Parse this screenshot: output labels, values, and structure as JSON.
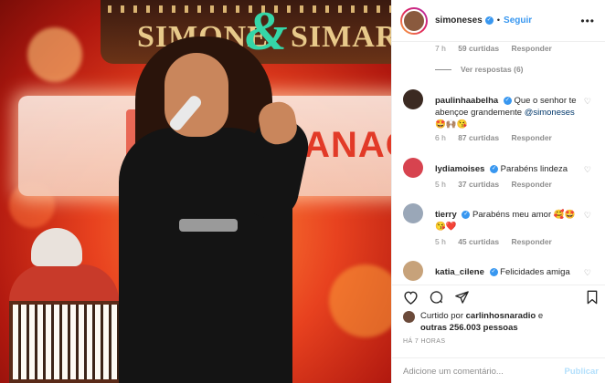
{
  "photo": {
    "banner_text": "GANAÇ",
    "logo_left": "SIMONE",
    "logo_amp": "&",
    "logo_right": "SIMARIA"
  },
  "header": {
    "username": "simoneses",
    "separator": "•",
    "follow_label": "Seguir",
    "more_label": "•••"
  },
  "first_comment_meta": {
    "time": "7 h",
    "likes": "59 curtidas",
    "reply": "Responder"
  },
  "view_replies": "Ver respostas (6)",
  "comments": [
    {
      "user": "paulinhaabelha",
      "text": "Que o senhor te abençoe grandemente",
      "mention": "@simoneses",
      "emoji": "🤩🙌🏽😘",
      "time": "6 h",
      "likes": "87 curtidas",
      "reply": "Responder",
      "avatar_color": "#3b2a22"
    },
    {
      "user": "lydiamoises",
      "text": "Parabéns lindeza",
      "mention": "",
      "emoji": "",
      "time": "5 h",
      "likes": "37 curtidas",
      "reply": "Responder",
      "avatar_color": "#d7434f"
    },
    {
      "user": "tierry",
      "text": "Parabéns meu amor",
      "mention": "",
      "emoji": "🥰🤩😘❤️",
      "time": "5 h",
      "likes": "45 curtidas",
      "reply": "Responder",
      "avatar_color": "#9aa7b8"
    },
    {
      "user": "katia_cilene",
      "text": "Felicidades amiga",
      "mention": "",
      "emoji": "",
      "time": "",
      "likes": "",
      "reply": "",
      "avatar_color": "#c7a27a"
    }
  ],
  "liked_by": {
    "prefix": "Curtido por",
    "user": "carlinhosnaradio",
    "middle": "e",
    "others": "outras 256.003 pessoas"
  },
  "timestamp": "HÁ 7 HORAS",
  "composer": {
    "placeholder": "Adicione um comentário...",
    "post_label": "Publicar"
  },
  "colors": {
    "accent": "#3897f0",
    "text": "#262626",
    "muted": "#8e8e8e",
    "post_disabled": "#b2dffc"
  },
  "icons": [
    "heart-icon",
    "comment-icon",
    "share-icon",
    "bookmark-icon",
    "more-options-icon",
    "verified-icon"
  ]
}
